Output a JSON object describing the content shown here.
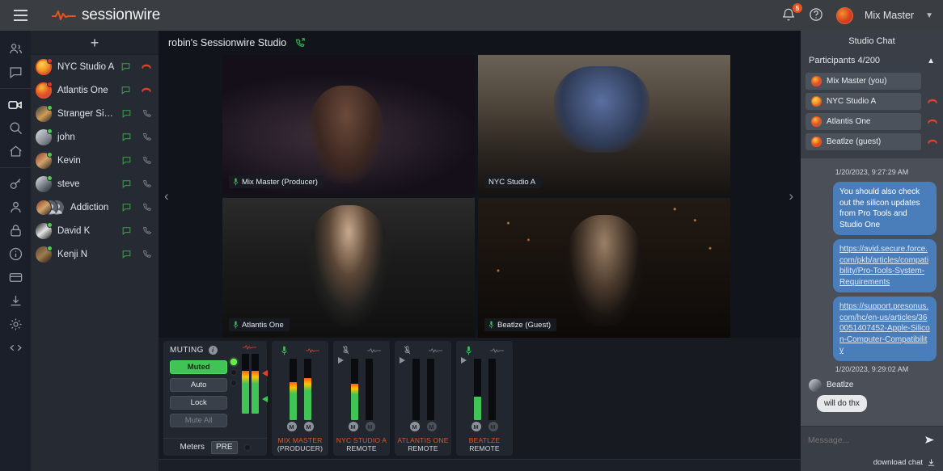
{
  "app": {
    "brand": "sessionwire",
    "menu_icon": "hamburger-icon",
    "notifications_count": "5",
    "user_name": "Mix Master"
  },
  "rail": {
    "items": [
      {
        "icon": "people-icon",
        "name": "contacts"
      },
      {
        "icon": "chat-bubble-icon",
        "name": "messages"
      },
      {
        "icon": "video-camera-icon",
        "name": "video",
        "active": true
      },
      {
        "icon": "search-icon",
        "name": "search"
      },
      {
        "icon": "home-icon",
        "name": "home"
      },
      {
        "icon": "key-icon",
        "name": "license"
      },
      {
        "icon": "person-icon",
        "name": "profile"
      },
      {
        "icon": "lock-icon",
        "name": "security"
      },
      {
        "icon": "info-icon",
        "name": "about"
      },
      {
        "icon": "credit-card-icon",
        "name": "billing"
      },
      {
        "icon": "download-icon",
        "name": "downloads"
      },
      {
        "icon": "gear-icon",
        "name": "settings"
      },
      {
        "icon": "code-icon",
        "name": "developer"
      }
    ]
  },
  "contacts": {
    "add_label": "+",
    "items": [
      {
        "name": "NYC Studio A",
        "status": "recording",
        "call": "hangup"
      },
      {
        "name": "Atlantis One",
        "status": "recording",
        "call": "hangup"
      },
      {
        "name": "Stranger Sings",
        "status": "online",
        "call": "phone"
      },
      {
        "name": "john",
        "status": "online",
        "call": "phone"
      },
      {
        "name": "Kevin",
        "status": "online",
        "call": "phone"
      },
      {
        "name": "steve",
        "status": "online",
        "call": "phone"
      },
      {
        "name": "Addiction",
        "status": "group",
        "call": "phone"
      },
      {
        "name": "David K",
        "status": "online",
        "call": "phone"
      },
      {
        "name": "Kenji N",
        "status": "online",
        "call": "phone"
      }
    ]
  },
  "studio": {
    "title": "robin's Sessionwire Studio",
    "call_icon": "incoming-call-icon",
    "layout_grid_icon": "grid-layout-icon",
    "layout_side_icon": "sidebar-layout-icon",
    "prev_icon": "chevron-left-icon",
    "next_icon": "chevron-right-icon",
    "tiles": [
      {
        "label": "Mix Master (Producer)",
        "mic": "mic-on-icon"
      },
      {
        "label": "NYC Studio A",
        "mic": "none"
      },
      {
        "label": "Atlantis One",
        "mic": "mic-on-icon"
      },
      {
        "label": "Beatlze (Guest)",
        "mic": "mic-on-icon"
      }
    ]
  },
  "mixer": {
    "muting": {
      "title": "MUTING",
      "info_icon": "info-icon",
      "buttons": [
        {
          "label": "Muted",
          "state": "active"
        },
        {
          "label": "Auto",
          "state": "led-on"
        },
        {
          "label": "Lock",
          "state": "led-off"
        },
        {
          "label": "Mute All",
          "state": "disabled"
        }
      ],
      "meters_label": "Meters",
      "pre_label": "PRE",
      "meter_left_pct": 72,
      "meter_right_pct": 72
    },
    "strips": [
      {
        "name": "MIX MASTER",
        "role": "(PRODUCER)",
        "mic": "mic-on-icon",
        "wave": "waveform-active-icon",
        "play": false,
        "meter_a": 62,
        "meter_b": 68,
        "mute_a": "on",
        "mute_b": "on"
      },
      {
        "name": "NYC STUDIO A",
        "role": "REMOTE",
        "mic": "mic-muted-icon",
        "wave": "waveform-idle-icon",
        "play": true,
        "meter_a": 59,
        "meter_b": 0,
        "mute_a": "on",
        "mute_b": "off"
      },
      {
        "name": "ATLANTIS ONE",
        "role": "REMOTE",
        "mic": "mic-muted-icon",
        "wave": "waveform-idle-icon",
        "play": true,
        "meter_a": 0,
        "meter_b": 0,
        "mute_a": "on",
        "mute_b": "off"
      },
      {
        "name": "BEATLZE",
        "role": "REMOTE",
        "mic": "mic-on-icon",
        "wave": "waveform-idle-icon",
        "play": true,
        "meter_a": 38,
        "meter_b": 0,
        "mute_a": "on",
        "mute_b": "off"
      }
    ],
    "mute_letter": "M"
  },
  "chat": {
    "header": "Studio Chat",
    "participants_label": "Participants 4/200",
    "collapse_icon": "chevron-up-icon",
    "participants": [
      {
        "name": "Mix Master (you)",
        "hangup": false
      },
      {
        "name": "NYC Studio A",
        "hangup": true
      },
      {
        "name": "Atlantis One",
        "hangup": true
      },
      {
        "name": "Beatlze (guest)",
        "hangup": true
      }
    ],
    "thread": [
      {
        "type": "timestamp",
        "text": "1/20/2023, 9:27:29 AM"
      },
      {
        "type": "out",
        "text": "You should also check out the silicon updates from Pro Tools and Studio One"
      },
      {
        "type": "out-link",
        "text": "https://avid.secure.force.com/pkb/articles/compatibility/Pro-Tools-System-Requirements"
      },
      {
        "type": "out-link",
        "text": "https://support.presonus.com/hc/en-us/articles/360051407452-Apple-Silicon-Computer-Compatibility"
      },
      {
        "type": "timestamp",
        "text": "1/20/2023, 9:29:02 AM"
      },
      {
        "type": "sender",
        "text": "Beatlze"
      },
      {
        "type": "in",
        "text": "will do thx"
      }
    ],
    "input_placeholder": "Message...",
    "input_value": "",
    "send_icon": "send-icon",
    "download_label": "download chat",
    "download_icon": "download-icon"
  },
  "colors": {
    "accent": "#e8541e",
    "green": "#3fc455",
    "red": "#e0442a",
    "bubble_out": "#4a7ebb"
  }
}
